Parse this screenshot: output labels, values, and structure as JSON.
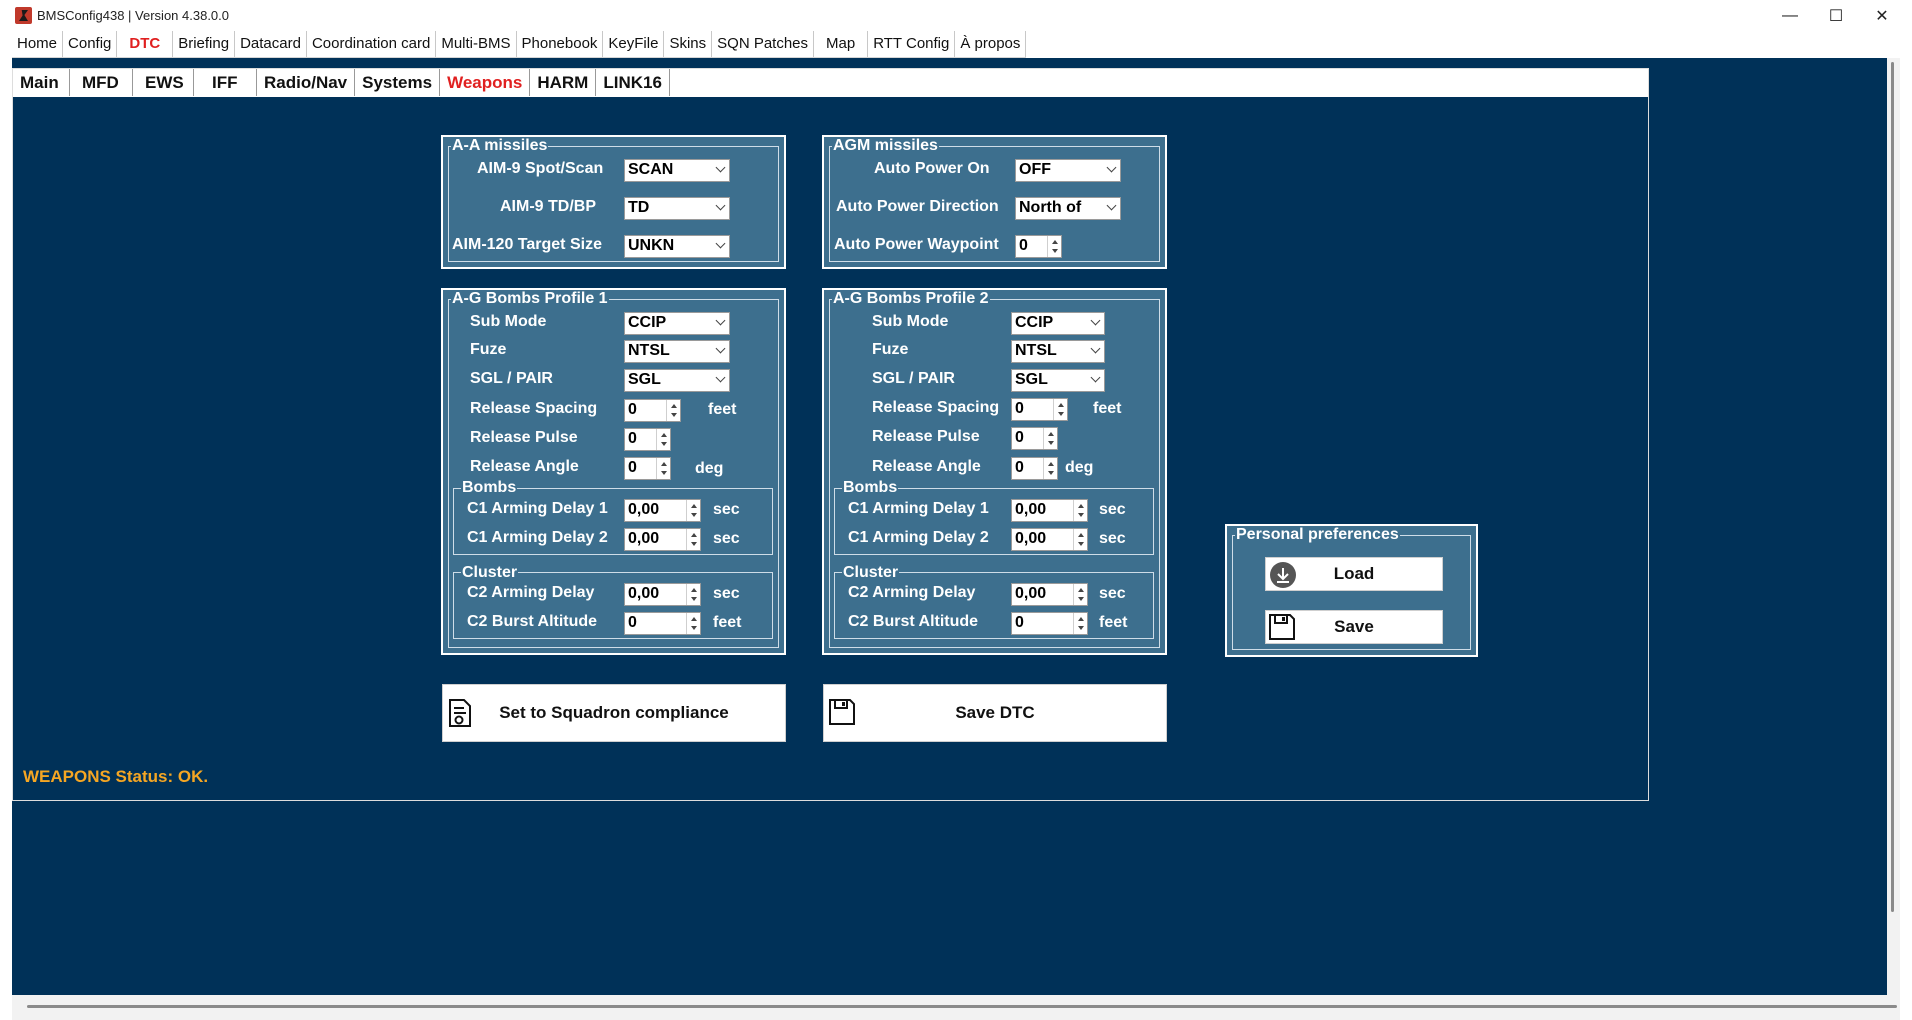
{
  "window": {
    "title": "BMSConfig438 | Version 4.38.0.0",
    "minimize": "—",
    "maximize": "☐",
    "close": "✕"
  },
  "main_tabs": [
    "Home",
    "Config",
    "DTC",
    "Briefing",
    "Datacard",
    "Coordination card",
    "Multi-BMS",
    "Phonebook",
    "KeyFile",
    "Skins",
    "SQN Patches",
    "Map",
    "RTT Config",
    "À propos"
  ],
  "main_tab_active": "DTC",
  "sub_tabs": [
    "Main",
    "MFD",
    "EWS",
    "IFF",
    "Radio/Nav",
    "Systems",
    "Weapons",
    "HARM",
    "LINK16"
  ],
  "sub_tab_active": "Weapons",
  "aa_missiles": {
    "legend": "A-A missiles",
    "aim9_spot_label": "AIM-9 Spot/Scan",
    "aim9_spot_value": "SCAN",
    "aim9_td_label": "AIM-9 TD/BP",
    "aim9_td_value": "TD",
    "aim120_label": "AIM-120 Target Size",
    "aim120_value": "UNKN"
  },
  "agm_missiles": {
    "legend": "AGM missiles",
    "auto_power_on_label": "Auto Power On",
    "auto_power_on_value": "OFF",
    "auto_power_dir_label": "Auto Power Direction",
    "auto_power_dir_value": "North of",
    "auto_power_wp_label": "Auto Power Waypoint",
    "auto_power_wp_value": "0"
  },
  "profile1": {
    "legend": "A-G Bombs Profile 1",
    "sub_mode_label": "Sub Mode",
    "sub_mode_value": "CCIP",
    "fuze_label": "Fuze",
    "fuze_value": "NTSL",
    "sgl_label": "SGL / PAIR",
    "sgl_value": "SGL",
    "spacing_label": "Release Spacing",
    "spacing_value": "0",
    "spacing_unit": "feet",
    "pulse_label": "Release Pulse",
    "pulse_value": "0",
    "angle_label": "Release Angle",
    "angle_value": "0",
    "angle_unit": "deg",
    "bombs_legend": "Bombs",
    "c1_delay1_label": "C1 Arming Delay 1",
    "c1_delay1_value": "0,00",
    "c1_delay1_unit": "sec",
    "c1_delay2_label": "C1 Arming Delay 2",
    "c1_delay2_value": "0,00",
    "c1_delay2_unit": "sec",
    "cluster_legend": "Cluster",
    "c2_delay_label": "C2 Arming Delay",
    "c2_delay_value": "0,00",
    "c2_delay_unit": "sec",
    "c2_burst_label": "C2 Burst Altitude",
    "c2_burst_value": "0",
    "c2_burst_unit": "feet"
  },
  "profile2": {
    "legend": "A-G Bombs Profile 2",
    "sub_mode_label": "Sub Mode",
    "sub_mode_value": "CCIP",
    "fuze_label": "Fuze",
    "fuze_value": "NTSL",
    "sgl_label": "SGL / PAIR",
    "sgl_value": "SGL",
    "spacing_label": "Release Spacing",
    "spacing_value": "0",
    "spacing_unit": "feet",
    "pulse_label": "Release Pulse",
    "pulse_value": "0",
    "angle_label": "Release Angle",
    "angle_value": "0",
    "angle_unit": "deg",
    "bombs_legend": "Bombs",
    "c1_delay1_label": "C1 Arming Delay 1",
    "c1_delay1_value": "0,00",
    "c1_delay1_unit": "sec",
    "c1_delay2_label": "C1 Arming Delay 2",
    "c1_delay2_value": "0,00",
    "c1_delay2_unit": "sec",
    "cluster_legend": "Cluster",
    "c2_delay_label": "C2 Arming Delay",
    "c2_delay_value": "0,00",
    "c2_delay_unit": "sec",
    "c2_burst_label": "C2 Burst Altitude",
    "c2_burst_value": "0",
    "c2_burst_unit": "feet"
  },
  "buttons": {
    "squadron": "Set to Squadron compliance",
    "save_dtc": "Save DTC"
  },
  "prefs": {
    "legend": "Personal preferences",
    "load": "Load",
    "save": "Save"
  },
  "status": "WEAPONS Status: OK.",
  "colors": {
    "background": "#003158",
    "group": "#3d6f8e",
    "active_tab": "#e02020",
    "status": "#f5a623"
  }
}
